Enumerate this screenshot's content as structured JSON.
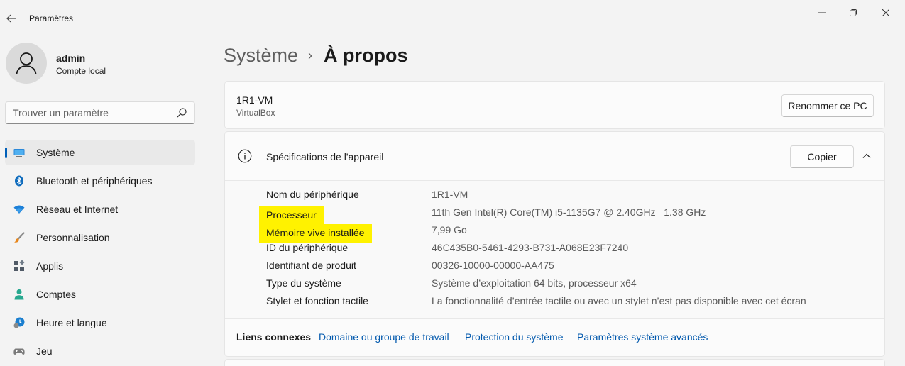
{
  "window": {
    "title": "Paramètres",
    "back_icon": "arrow-left-icon",
    "minimize_icon": "minimize-icon",
    "maximize_icon": "maximize-icon",
    "close_icon": "close-icon"
  },
  "user": {
    "name": "admin",
    "account_type": "Compte local"
  },
  "search": {
    "placeholder": "Trouver un paramètre"
  },
  "sidebar": {
    "items": [
      {
        "label": "Système",
        "icon": "monitor-icon",
        "active": true
      },
      {
        "label": "Bluetooth et périphériques",
        "icon": "bluetooth-icon",
        "active": false
      },
      {
        "label": "Réseau et Internet",
        "icon": "wifi-icon",
        "active": false
      },
      {
        "label": "Personnalisation",
        "icon": "brush-icon",
        "active": false
      },
      {
        "label": "Applis",
        "icon": "apps-icon",
        "active": false
      },
      {
        "label": "Comptes",
        "icon": "person-icon",
        "active": false
      },
      {
        "label": "Heure et langue",
        "icon": "clock-globe-icon",
        "active": false
      },
      {
        "label": "Jeu",
        "icon": "gamepad-icon",
        "active": false
      }
    ]
  },
  "breadcrumb": {
    "parent": "Système",
    "separator": "›",
    "current": "À propos"
  },
  "pc_card": {
    "name": "1R1-VM",
    "model": "VirtualBox",
    "rename_button": "Renommer ce PC"
  },
  "specs": {
    "title": "Spécifications de l'appareil",
    "copy_button": "Copier",
    "rows": [
      {
        "label": "Nom du périphérique",
        "value": "1R1-VM",
        "highlight": false
      },
      {
        "label": "Processeur",
        "value": "11th Gen Intel(R) Core(TM) i5-1135G7 @ 2.40GHz   1.38 GHz",
        "highlight": true
      },
      {
        "label": "Mémoire vive installée",
        "value": "7,99 Go",
        "highlight": true
      },
      {
        "label": "ID du périphérique",
        "value": "46C435B0-5461-4293-B731-A068E23F7240",
        "highlight": false
      },
      {
        "label": "Identifiant de produit",
        "value": "00326-10000-00000-AA475",
        "highlight": false
      },
      {
        "label": "Type du système",
        "value": "Système d’exploitation 64 bits, processeur x64",
        "highlight": false
      },
      {
        "label": "Stylet et fonction tactile",
        "value": "La fonctionnalité d’entrée tactile ou avec un stylet n’est pas disponible avec cet écran",
        "highlight": false
      }
    ]
  },
  "related_links": {
    "title": "Liens connexes",
    "links": [
      "Domaine ou groupe de travail",
      "Protection du système",
      "Paramètres système avancés"
    ]
  },
  "colors": {
    "accent": "#005fb8",
    "highlight": "#fff200",
    "link": "#0058ad"
  }
}
